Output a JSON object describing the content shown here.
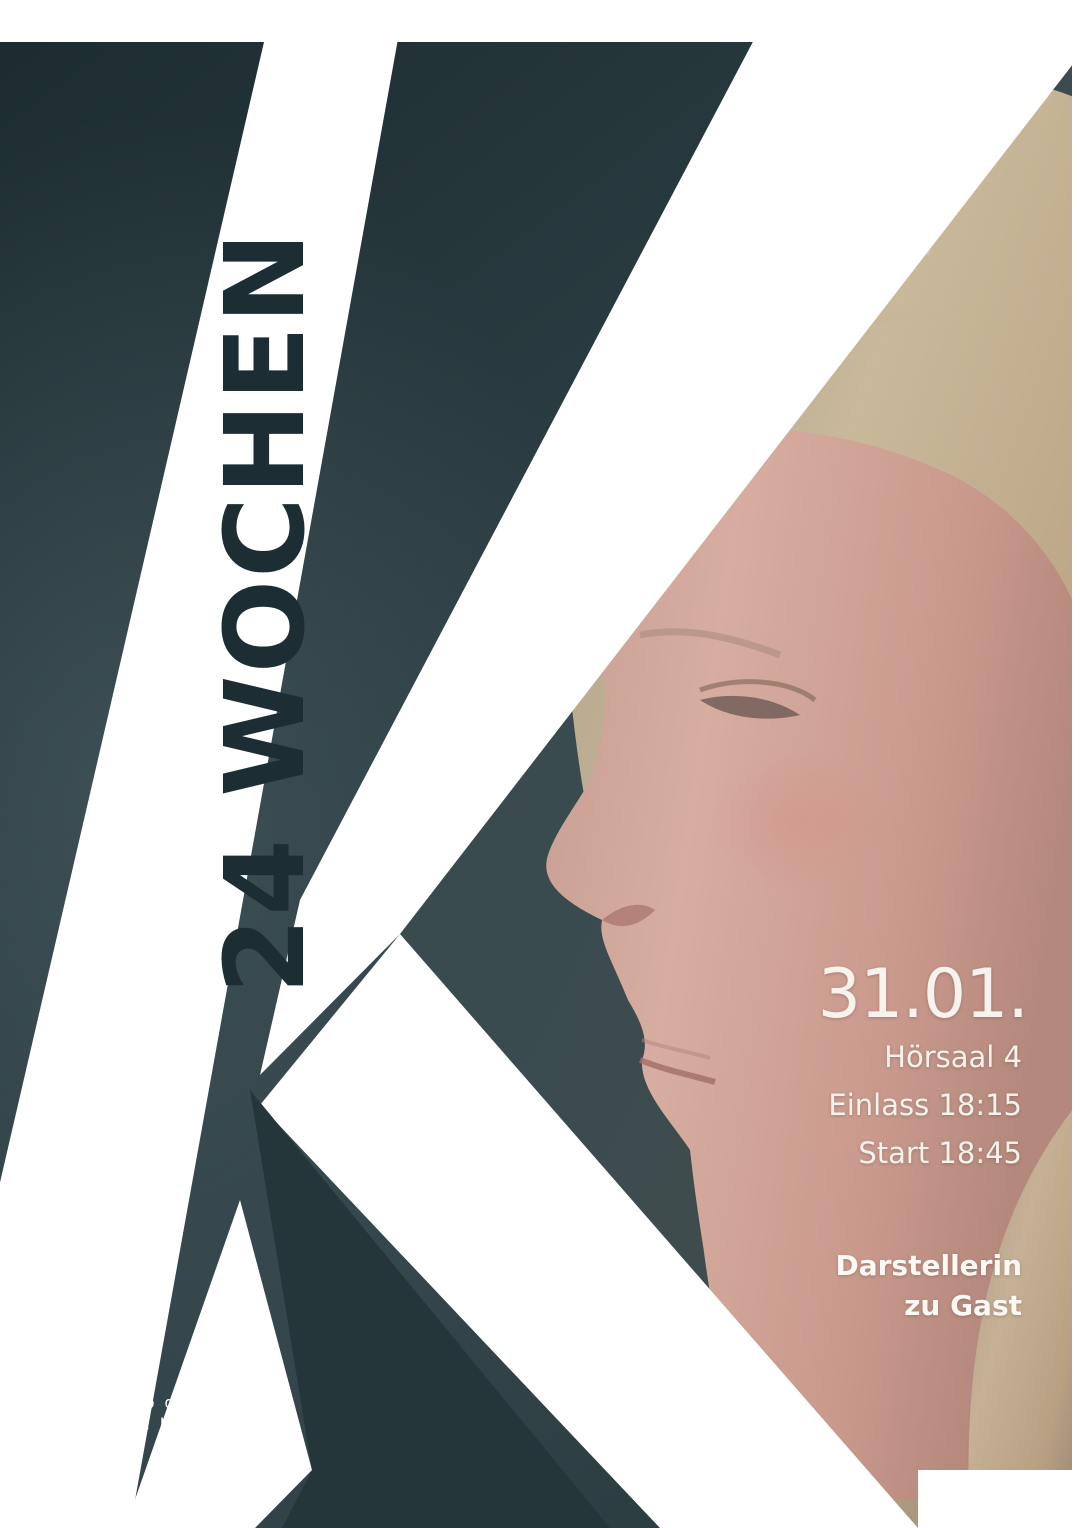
{
  "poster": {
    "film_title": "24 WOCHEN",
    "screening": {
      "date": "31.01.",
      "venue": "Hörsaal 4",
      "admission": "Einlass 18:15",
      "start": "Start 18:45"
    },
    "guest_note": {
      "line1": "Darstellerin",
      "line2": "zu Gast"
    },
    "organizer": {
      "line1": "Das Kino der",
      "line2": "Universität Leipzig"
    }
  },
  "colors": {
    "backdrop_dark": "#1f3035",
    "letter_white": "#ffffff",
    "title_text": "#1c2e33",
    "info_text": "#f6f2ee"
  },
  "imagery": {
    "large_letter": "K",
    "photo": "profile-portrait"
  }
}
